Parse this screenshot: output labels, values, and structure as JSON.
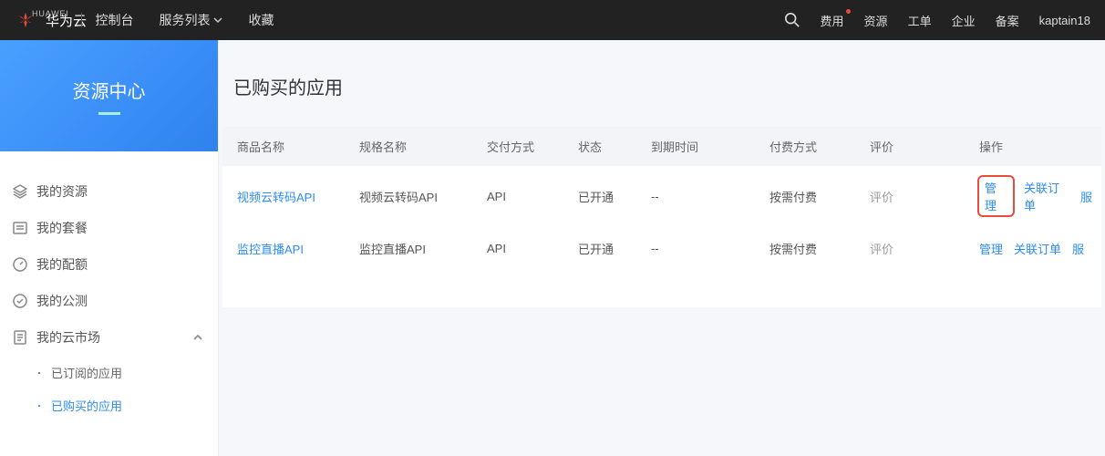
{
  "brand": {
    "huaweiText": "HUAWEI",
    "name": "华为云"
  },
  "topnav": {
    "console": "控制台",
    "services": "服务列表",
    "favorites": "收藏"
  },
  "rightnav": {
    "fee": "费用",
    "resource": "资源",
    "workorder": "工单",
    "enterprise": "企业",
    "record": "备案",
    "user": "kaptain18"
  },
  "sidebar": {
    "title": "资源中心",
    "items": [
      "我的资源",
      "我的套餐",
      "我的配额",
      "我的公测"
    ],
    "market": "我的云市场",
    "children": {
      "subscribed": "已订阅的应用",
      "purchased": "已购买的应用"
    }
  },
  "page": {
    "title": "已购买的应用"
  },
  "table": {
    "headers": {
      "name": "商品名称",
      "spec": "规格名称",
      "delivery": "交付方式",
      "status": "状态",
      "expire": "到期时间",
      "pay": "付费方式",
      "rate": "评价",
      "op": "操作"
    },
    "labels": {
      "rate": "评价",
      "manage": "管理",
      "relate": "关联订单",
      "serv": "服"
    },
    "rows": [
      {
        "name": "视频云转码API",
        "spec": "视频云转码API",
        "delivery": "API",
        "status": "已开通",
        "expire": "--",
        "pay": "按需付费",
        "highlight": true
      },
      {
        "name": "监控直播API",
        "spec": "监控直播API",
        "delivery": "API",
        "status": "已开通",
        "expire": "--",
        "pay": "按需付费",
        "highlight": false
      }
    ]
  }
}
